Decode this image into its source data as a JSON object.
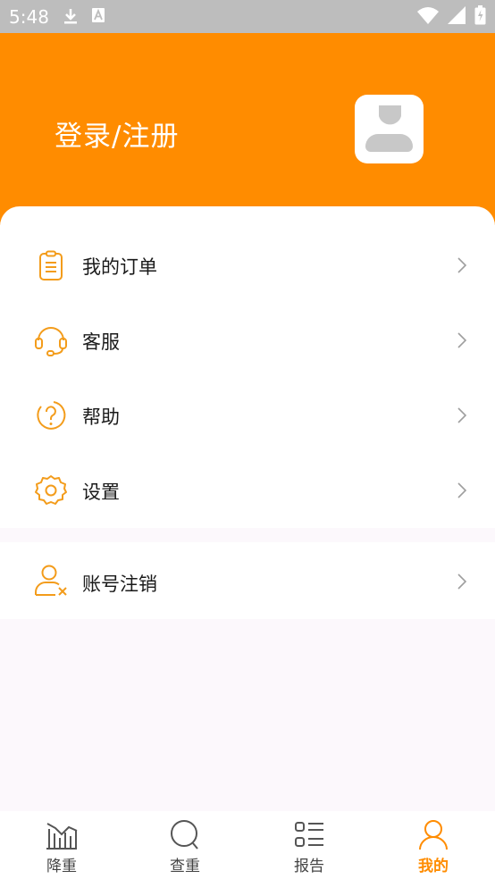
{
  "status_bar": {
    "time": "5:48",
    "icons": [
      "download-icon",
      "a-icon",
      "wifi-icon",
      "signal-icon",
      "battery-icon"
    ]
  },
  "header": {
    "login_label": "登录/注册",
    "accent_color": "#ff8c00"
  },
  "menu": {
    "items": [
      {
        "label": "我的订单",
        "icon": "order-list-icon"
      },
      {
        "label": "客服",
        "icon": "headset-icon"
      },
      {
        "label": "帮助",
        "icon": "help-icon"
      },
      {
        "label": "设置",
        "icon": "gear-icon"
      }
    ],
    "account": {
      "label": "账号注销",
      "icon": "user-remove-icon"
    }
  },
  "tabbar": {
    "items": [
      {
        "label": "降重",
        "icon": "chart-icon"
      },
      {
        "label": "查重",
        "icon": "search-icon"
      },
      {
        "label": "报告",
        "icon": "list-icon"
      },
      {
        "label": "我的",
        "icon": "user-icon",
        "active": true
      }
    ]
  }
}
